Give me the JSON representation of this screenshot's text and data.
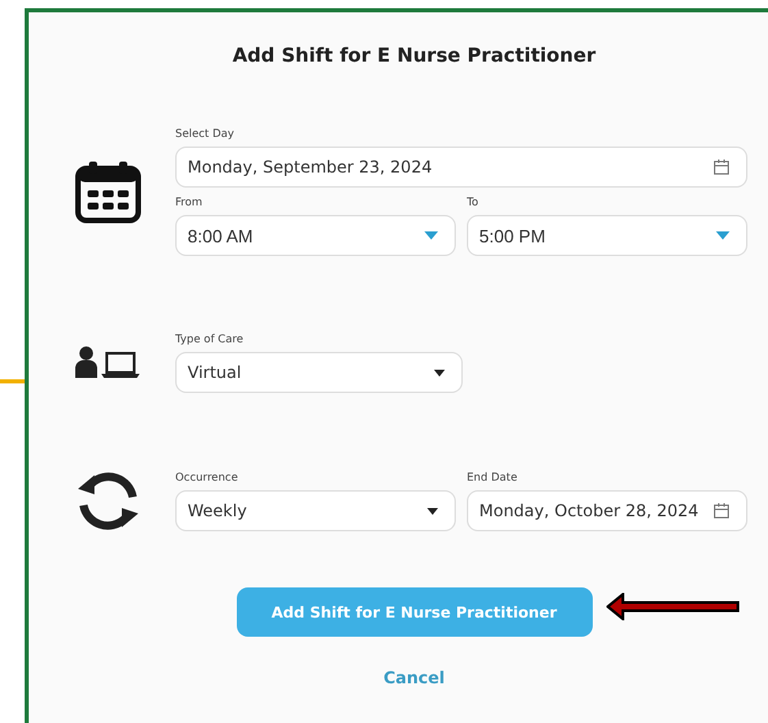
{
  "dialog": {
    "title": "Add Shift for E Nurse Practitioner"
  },
  "sections": [
    {
      "kind": "calendar",
      "rows": [
        [
          {
            "kind": "date",
            "label": "Select Day",
            "value": "Monday, September 23, 2024"
          }
        ],
        [
          {
            "kind": "time",
            "label": "From",
            "value": "8:00 AM"
          },
          {
            "kind": "time",
            "label": "To",
            "value": "5:00 PM"
          }
        ]
      ]
    },
    {
      "kind": "person-laptop",
      "rows": [
        [
          {
            "kind": "select",
            "label": "Type of Care",
            "value": "Virtual"
          }
        ]
      ]
    },
    {
      "kind": "cycle",
      "rows": [
        [
          {
            "kind": "select",
            "label": "Occurrence",
            "value": "Weekly"
          },
          {
            "kind": "date",
            "label": "End Date",
            "value": "Monday, October 28, 2024"
          }
        ]
      ]
    }
  ],
  "primary_button": "Add Shift for E Nurse Practitioner",
  "cancel_button": "Cancel"
}
